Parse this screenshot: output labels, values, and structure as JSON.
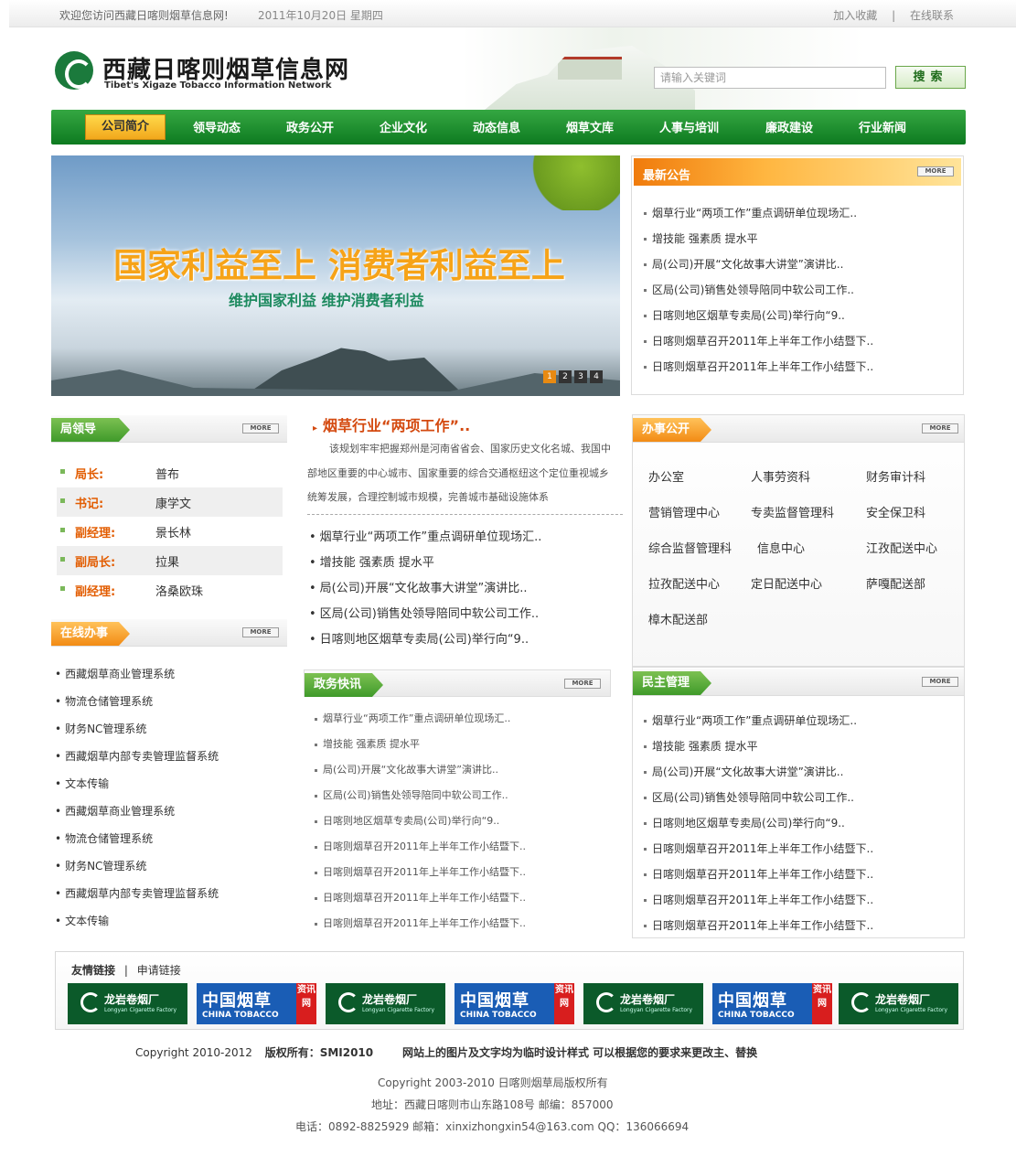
{
  "topbar": {
    "welcome": "欢迎您访问西藏日喀则烟草信息网!",
    "date": "2011年10月20日  星期四",
    "favorite": "加入收藏",
    "sep": "|",
    "contact": "在线联系"
  },
  "header": {
    "title": "西藏日喀则烟草信息网",
    "subtitle": "Tibet's Xigaze Tobacco Information Network",
    "search_placeholder": "请输入关键词",
    "search_button": "搜索"
  },
  "nav": {
    "items": [
      "公司简介",
      "领导动态",
      "政务公开",
      "企业文化",
      "动态信息",
      "烟草文库",
      "人事与培训",
      "廉政建设",
      "行业新闻"
    ]
  },
  "banner": {
    "headline": "国家利益至上 消费者利益至上",
    "subline": "维护国家利益 维护消费者利益",
    "pages": [
      "1",
      "2",
      "3",
      "4"
    ],
    "current_page": 1
  },
  "more_label": "MORE",
  "notice": {
    "title": "最新公告",
    "items": [
      "烟草行业“两项工作”重点调研单位现场汇..",
      "增技能 强素质 提水平",
      "局(公司)开展“文化故事大讲堂”演讲比..",
      "区局(公司)销售处领导陪同中软公司工作..",
      "日喀则地区烟草专卖局(公司)举行向“9..",
      "日喀则烟草召开2011年上半年工作小结暨下..",
      "日喀则烟草召开2011年上半年工作小结暨下.."
    ]
  },
  "leaders": {
    "title": "局领导",
    "rows": [
      {
        "role": "局长:",
        "name": "普布"
      },
      {
        "role": "书记:",
        "name": "康学文"
      },
      {
        "role": "副经理:",
        "name": "景长林"
      },
      {
        "role": "副局长:",
        "name": "拉果"
      },
      {
        "role": "副经理:",
        "name": "洛桑欧珠"
      }
    ]
  },
  "online": {
    "title": "在线办事",
    "items": [
      "西藏烟草商业管理系统",
      "物流仓储管理系统",
      "财务NC管理系统",
      "西藏烟草内部专卖管理监督系统",
      "文本传输",
      "西藏烟草商业管理系统",
      "物流仓储管理系统",
      "财务NC管理系统",
      "西藏烟草内部专卖管理监督系统",
      "文本传输"
    ]
  },
  "feature": {
    "title": "烟草行业“两项工作”..",
    "summary": "该规划牢牢把握郑州是河南省省会、国家历史文化名城、我国中部地区重要的中心城市、国家重要的综合交通枢纽这个定位重视城乡统筹发展，合理控制城市规模，完善城市基础设施体系",
    "items": [
      "烟草行业“两项工作”重点调研单位现场汇..",
      "增技能 强素质 提水平",
      "局(公司)开展“文化故事大讲堂”演讲比..",
      "区局(公司)销售处领导陪同中软公司工作..",
      "日喀则地区烟草专卖局(公司)举行向“9.."
    ]
  },
  "gov_news": {
    "title": "政务快讯",
    "items": [
      "烟草行业“两项工作”重点调研单位现场汇..",
      "增技能 强素质 提水平",
      "局(公司)开展“文化故事大讲堂”演讲比..",
      "区局(公司)销售处领导陪同中软公司工作..",
      "日喀则地区烟草专卖局(公司)举行向“9..",
      "日喀则烟草召开2011年上半年工作小结暨下..",
      "日喀则烟草召开2011年上半年工作小结暨下..",
      "日喀则烟草召开2011年上半年工作小结暨下..",
      "日喀则烟草召开2011年上半年工作小结暨下.."
    ]
  },
  "office": {
    "title": "办事公开",
    "items": [
      "办公室",
      "人事劳资科",
      "财务审计科",
      "营销管理中心",
      "专卖监督管理科",
      "安全保卫科",
      "综合监督管理科",
      "信息中心",
      "江孜配送中心",
      "拉孜配送中心",
      "定日配送中心",
      "萨嘎配送部",
      "樟木配送部"
    ]
  },
  "democracy": {
    "title": "民主管理",
    "items": [
      "烟草行业“两项工作”重点调研单位现场汇..",
      "增技能 强素质 提水平",
      "局(公司)开展“文化故事大讲堂”演讲比..",
      "区局(公司)销售处领导陪同中软公司工作..",
      "日喀则地区烟草专卖局(公司)举行向“9..",
      "日喀则烟草召开2011年上半年工作小结暨下..",
      "日喀则烟草召开2011年上半年工作小结暨下..",
      "日喀则烟草召开2011年上半年工作小结暨下..",
      "日喀则烟草召开2011年上半年工作小结暨下.."
    ]
  },
  "friend_links": {
    "title": "友情链接",
    "sep": "|",
    "apply": "申请链接",
    "logos": [
      {
        "name": "龙岩卷烟厂",
        "sub": "Longyan Cigarette Factory"
      },
      {
        "name": "中国烟草",
        "sub": "CHINA TOBACCO",
        "tag": "资讯网"
      },
      {
        "name": "龙岩卷烟厂",
        "sub": "Longyan Cigarette Factory"
      },
      {
        "name": "中国烟草",
        "sub": "CHINA TOBACCO",
        "tag": "资讯网"
      },
      {
        "name": "龙岩卷烟厂",
        "sub": "Longyan Cigarette Factory"
      },
      {
        "name": "中国烟草",
        "sub": "CHINA TOBACCO",
        "tag": "资讯网"
      },
      {
        "name": "龙岩卷烟厂",
        "sub": "Longyan Cigarette Factory"
      }
    ]
  },
  "footer": {
    "copyright1": "Copyright 2010-2012",
    "rights": "版权所有：SMI2010",
    "note": "网站上的图片及文字均为临时设计样式 可以根据您的要求来更改主、替换",
    "copyright2": "Copyright 2003-2010 日喀则烟草局版权所有",
    "address": "地址：西藏日喀则市山东路108号 邮编：857000",
    "phone": "电话：0892-8825929 邮箱：xinxizhongxin54@163.com QQ：136066694"
  },
  "colors": {
    "nav_green": "#0d7a20",
    "orange": "#f28b14",
    "role_orange": "#e25c00",
    "feature_red": "#d44a10"
  }
}
